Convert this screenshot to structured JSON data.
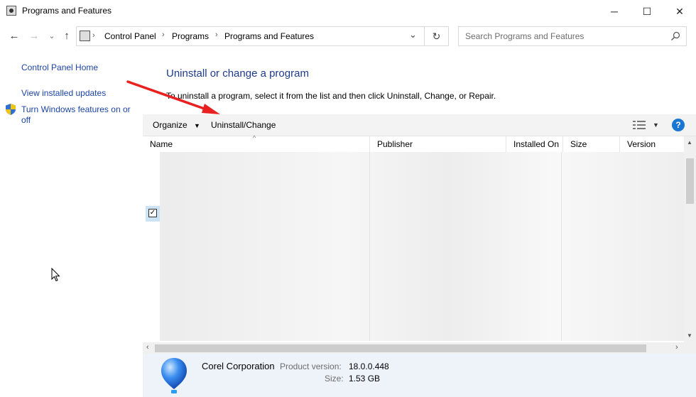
{
  "window": {
    "title": "Programs and Features",
    "minimize": "─",
    "maximize": "☐",
    "close": "✕"
  },
  "nav": {
    "back": "←",
    "forward": "→",
    "recent": "⌄",
    "up": "↑"
  },
  "address": {
    "crumbs": [
      "Control Panel",
      "Programs",
      "Programs and Features"
    ],
    "separator": "›",
    "dropdown": "⌄",
    "refresh": "↻"
  },
  "search": {
    "placeholder": "Search Programs and Features",
    "icon": "search-icon"
  },
  "sidebar": {
    "home": "Control Panel Home",
    "updates": "View installed updates",
    "features": "Turn Windows features on or off"
  },
  "main": {
    "heading": "Uninstall or change a program",
    "instruction": "To uninstall a program, select it from the list and then click Uninstall, Change, or Repair."
  },
  "toolbar": {
    "organize": "Organize",
    "uninstall_change": "Uninstall/Change",
    "help": "?"
  },
  "columns": [
    "Name",
    "Publisher",
    "Installed On",
    "Size",
    "Version"
  ],
  "details": {
    "publisher": "Corel Corporation",
    "product_version_label": "Product version:",
    "product_version": "18.0.0.448",
    "size_label": "Size:",
    "size": "1.53 GB"
  },
  "colors": {
    "link": "#1d44a3",
    "heading": "#1e3a8a",
    "arrow": "#e8201f",
    "details_bg": "#eef3fa"
  }
}
